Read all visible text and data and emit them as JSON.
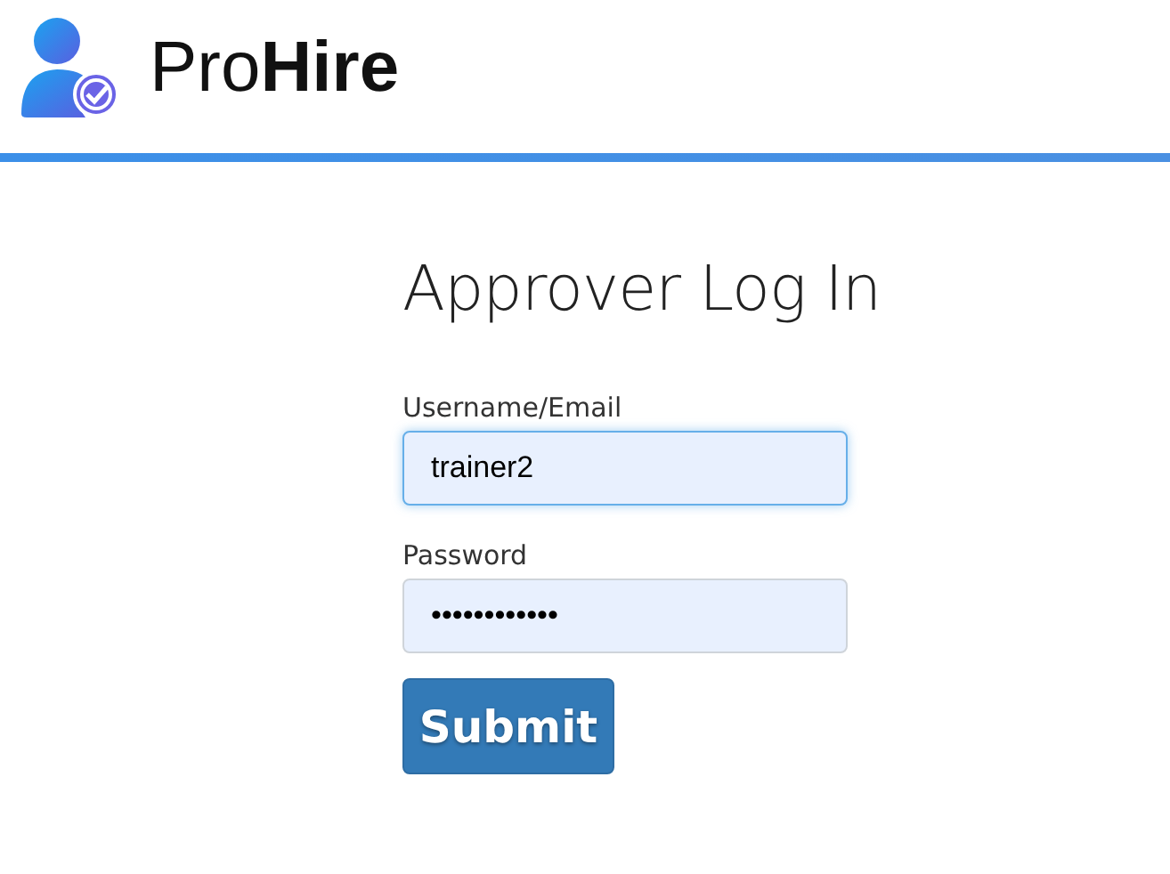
{
  "brand": {
    "name": "Pro**Hire**"
  },
  "form": {
    "title": "Approver Log In",
    "fields": [
      {
        "label": "Username/Email",
        "value": "trainer2",
        "focused": true
      },
      {
        "label": "Password",
        "value": "••••••••••••",
        "focused": false
      }
    ],
    "submit": "Submit"
  }
}
